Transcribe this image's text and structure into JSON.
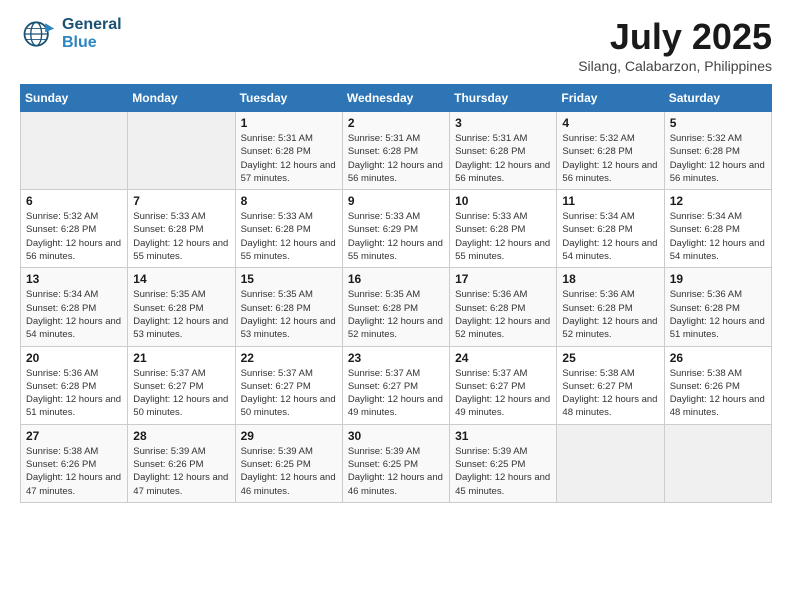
{
  "header": {
    "logo_line1": "General",
    "logo_line2": "Blue",
    "month": "July 2025",
    "location": "Silang, Calabarzon, Philippines"
  },
  "days_of_week": [
    "Sunday",
    "Monday",
    "Tuesday",
    "Wednesday",
    "Thursday",
    "Friday",
    "Saturday"
  ],
  "weeks": [
    [
      {
        "day": "",
        "empty": true
      },
      {
        "day": "",
        "empty": true
      },
      {
        "day": "1",
        "info": "Sunrise: 5:31 AM\nSunset: 6:28 PM\nDaylight: 12 hours and 57 minutes."
      },
      {
        "day": "2",
        "info": "Sunrise: 5:31 AM\nSunset: 6:28 PM\nDaylight: 12 hours and 56 minutes."
      },
      {
        "day": "3",
        "info": "Sunrise: 5:31 AM\nSunset: 6:28 PM\nDaylight: 12 hours and 56 minutes."
      },
      {
        "day": "4",
        "info": "Sunrise: 5:32 AM\nSunset: 6:28 PM\nDaylight: 12 hours and 56 minutes."
      },
      {
        "day": "5",
        "info": "Sunrise: 5:32 AM\nSunset: 6:28 PM\nDaylight: 12 hours and 56 minutes."
      }
    ],
    [
      {
        "day": "6",
        "info": "Sunrise: 5:32 AM\nSunset: 6:28 PM\nDaylight: 12 hours and 56 minutes."
      },
      {
        "day": "7",
        "info": "Sunrise: 5:33 AM\nSunset: 6:28 PM\nDaylight: 12 hours and 55 minutes."
      },
      {
        "day": "8",
        "info": "Sunrise: 5:33 AM\nSunset: 6:28 PM\nDaylight: 12 hours and 55 minutes."
      },
      {
        "day": "9",
        "info": "Sunrise: 5:33 AM\nSunset: 6:29 PM\nDaylight: 12 hours and 55 minutes."
      },
      {
        "day": "10",
        "info": "Sunrise: 5:33 AM\nSunset: 6:28 PM\nDaylight: 12 hours and 55 minutes."
      },
      {
        "day": "11",
        "info": "Sunrise: 5:34 AM\nSunset: 6:28 PM\nDaylight: 12 hours and 54 minutes."
      },
      {
        "day": "12",
        "info": "Sunrise: 5:34 AM\nSunset: 6:28 PM\nDaylight: 12 hours and 54 minutes."
      }
    ],
    [
      {
        "day": "13",
        "info": "Sunrise: 5:34 AM\nSunset: 6:28 PM\nDaylight: 12 hours and 54 minutes."
      },
      {
        "day": "14",
        "info": "Sunrise: 5:35 AM\nSunset: 6:28 PM\nDaylight: 12 hours and 53 minutes."
      },
      {
        "day": "15",
        "info": "Sunrise: 5:35 AM\nSunset: 6:28 PM\nDaylight: 12 hours and 53 minutes."
      },
      {
        "day": "16",
        "info": "Sunrise: 5:35 AM\nSunset: 6:28 PM\nDaylight: 12 hours and 52 minutes."
      },
      {
        "day": "17",
        "info": "Sunrise: 5:36 AM\nSunset: 6:28 PM\nDaylight: 12 hours and 52 minutes."
      },
      {
        "day": "18",
        "info": "Sunrise: 5:36 AM\nSunset: 6:28 PM\nDaylight: 12 hours and 52 minutes."
      },
      {
        "day": "19",
        "info": "Sunrise: 5:36 AM\nSunset: 6:28 PM\nDaylight: 12 hours and 51 minutes."
      }
    ],
    [
      {
        "day": "20",
        "info": "Sunrise: 5:36 AM\nSunset: 6:28 PM\nDaylight: 12 hours and 51 minutes."
      },
      {
        "day": "21",
        "info": "Sunrise: 5:37 AM\nSunset: 6:27 PM\nDaylight: 12 hours and 50 minutes."
      },
      {
        "day": "22",
        "info": "Sunrise: 5:37 AM\nSunset: 6:27 PM\nDaylight: 12 hours and 50 minutes."
      },
      {
        "day": "23",
        "info": "Sunrise: 5:37 AM\nSunset: 6:27 PM\nDaylight: 12 hours and 49 minutes."
      },
      {
        "day": "24",
        "info": "Sunrise: 5:37 AM\nSunset: 6:27 PM\nDaylight: 12 hours and 49 minutes."
      },
      {
        "day": "25",
        "info": "Sunrise: 5:38 AM\nSunset: 6:27 PM\nDaylight: 12 hours and 48 minutes."
      },
      {
        "day": "26",
        "info": "Sunrise: 5:38 AM\nSunset: 6:26 PM\nDaylight: 12 hours and 48 minutes."
      }
    ],
    [
      {
        "day": "27",
        "info": "Sunrise: 5:38 AM\nSunset: 6:26 PM\nDaylight: 12 hours and 47 minutes."
      },
      {
        "day": "28",
        "info": "Sunrise: 5:39 AM\nSunset: 6:26 PM\nDaylight: 12 hours and 47 minutes."
      },
      {
        "day": "29",
        "info": "Sunrise: 5:39 AM\nSunset: 6:25 PM\nDaylight: 12 hours and 46 minutes."
      },
      {
        "day": "30",
        "info": "Sunrise: 5:39 AM\nSunset: 6:25 PM\nDaylight: 12 hours and 46 minutes."
      },
      {
        "day": "31",
        "info": "Sunrise: 5:39 AM\nSunset: 6:25 PM\nDaylight: 12 hours and 45 minutes."
      },
      {
        "day": "",
        "empty": true
      },
      {
        "day": "",
        "empty": true
      }
    ]
  ]
}
